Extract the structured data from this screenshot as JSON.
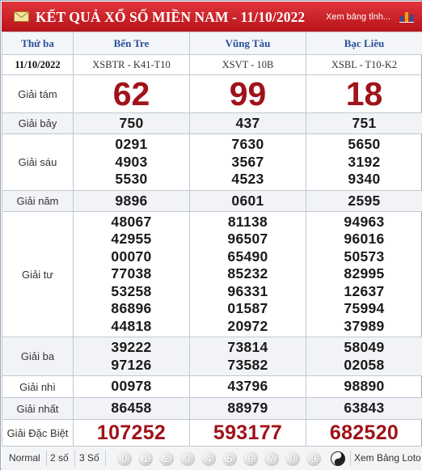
{
  "header": {
    "title": "KẾT QUẢ XỔ SỐ MIỀN NAM - 11/10/2022",
    "view_link": "Xem bảng tỉnh..."
  },
  "columns": {
    "day": "Thứ ba",
    "date": "11/10/2022",
    "stations": [
      {
        "name": "Bến Tre",
        "code": "XSBTR - K41-T10"
      },
      {
        "name": "Vũng Tàu",
        "code": "XSVT - 10B"
      },
      {
        "name": "Bạc Liêu",
        "code": "XSBL - T10-K2"
      }
    ]
  },
  "prizes": {
    "g8": {
      "label": "Giải tám",
      "values": [
        "62",
        "99",
        "18"
      ]
    },
    "g7": {
      "label": "Giải bảy",
      "values": [
        "750",
        "437",
        "751"
      ]
    },
    "g6": {
      "label": "Giải sáu",
      "values": [
        [
          "0291",
          "4903",
          "5530"
        ],
        [
          "7630",
          "3567",
          "4523"
        ],
        [
          "5650",
          "3192",
          "9340"
        ]
      ]
    },
    "g5": {
      "label": "Giải năm",
      "values": [
        "9896",
        "0601",
        "2595"
      ]
    },
    "g4": {
      "label": "Giải tư",
      "values": [
        [
          "48067",
          "42955",
          "00070",
          "77038",
          "53258",
          "86896",
          "44818"
        ],
        [
          "81138",
          "96507",
          "65490",
          "85232",
          "96331",
          "01587",
          "20972"
        ],
        [
          "94963",
          "96016",
          "50573",
          "82995",
          "12637",
          "75994",
          "37989"
        ]
      ]
    },
    "g3": {
      "label": "Giải ba",
      "values": [
        [
          "39222",
          "97126"
        ],
        [
          "73814",
          "73582"
        ],
        [
          "58049",
          "02058"
        ]
      ]
    },
    "g2": {
      "label": "Giải nhì",
      "values": [
        "00978",
        "43796",
        "98890"
      ]
    },
    "g1": {
      "label": "Giải nhất",
      "values": [
        "86458",
        "88979",
        "63843"
      ]
    },
    "special": {
      "label": "Giải Đặc Biệt",
      "values": [
        "107252",
        "593177",
        "682520"
      ]
    }
  },
  "footer": {
    "modes": [
      "Normal",
      "2 số",
      "3 Số"
    ],
    "digits": [
      "0",
      "1",
      "2",
      "3",
      "4",
      "5",
      "6",
      "7",
      "8",
      "9"
    ],
    "view_loto": "Xem Bảng Loto"
  },
  "colors": {
    "title_bg": "#c91d24",
    "prize_red": "#a0121a",
    "header_blue": "#2a4f9c"
  }
}
